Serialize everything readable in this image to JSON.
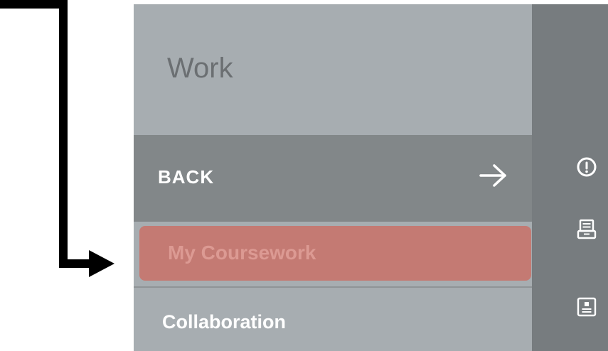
{
  "menu": {
    "title": "Work",
    "back_label": "BACK",
    "items": [
      {
        "label": "My Coursework",
        "active": true
      },
      {
        "label": "Collaboration",
        "active": false
      }
    ]
  },
  "icons": {
    "back_arrow": "arrow-right-icon",
    "rail": [
      "info-icon",
      "archive-tray-icon",
      "contact-card-icon"
    ]
  },
  "colors": {
    "panel_bg": "#a7adb1",
    "back_row_bg": "#828789",
    "active_item_bg": "#c47a73",
    "active_item_text": "#dc9a93",
    "rail_bg": "#777c7f"
  }
}
